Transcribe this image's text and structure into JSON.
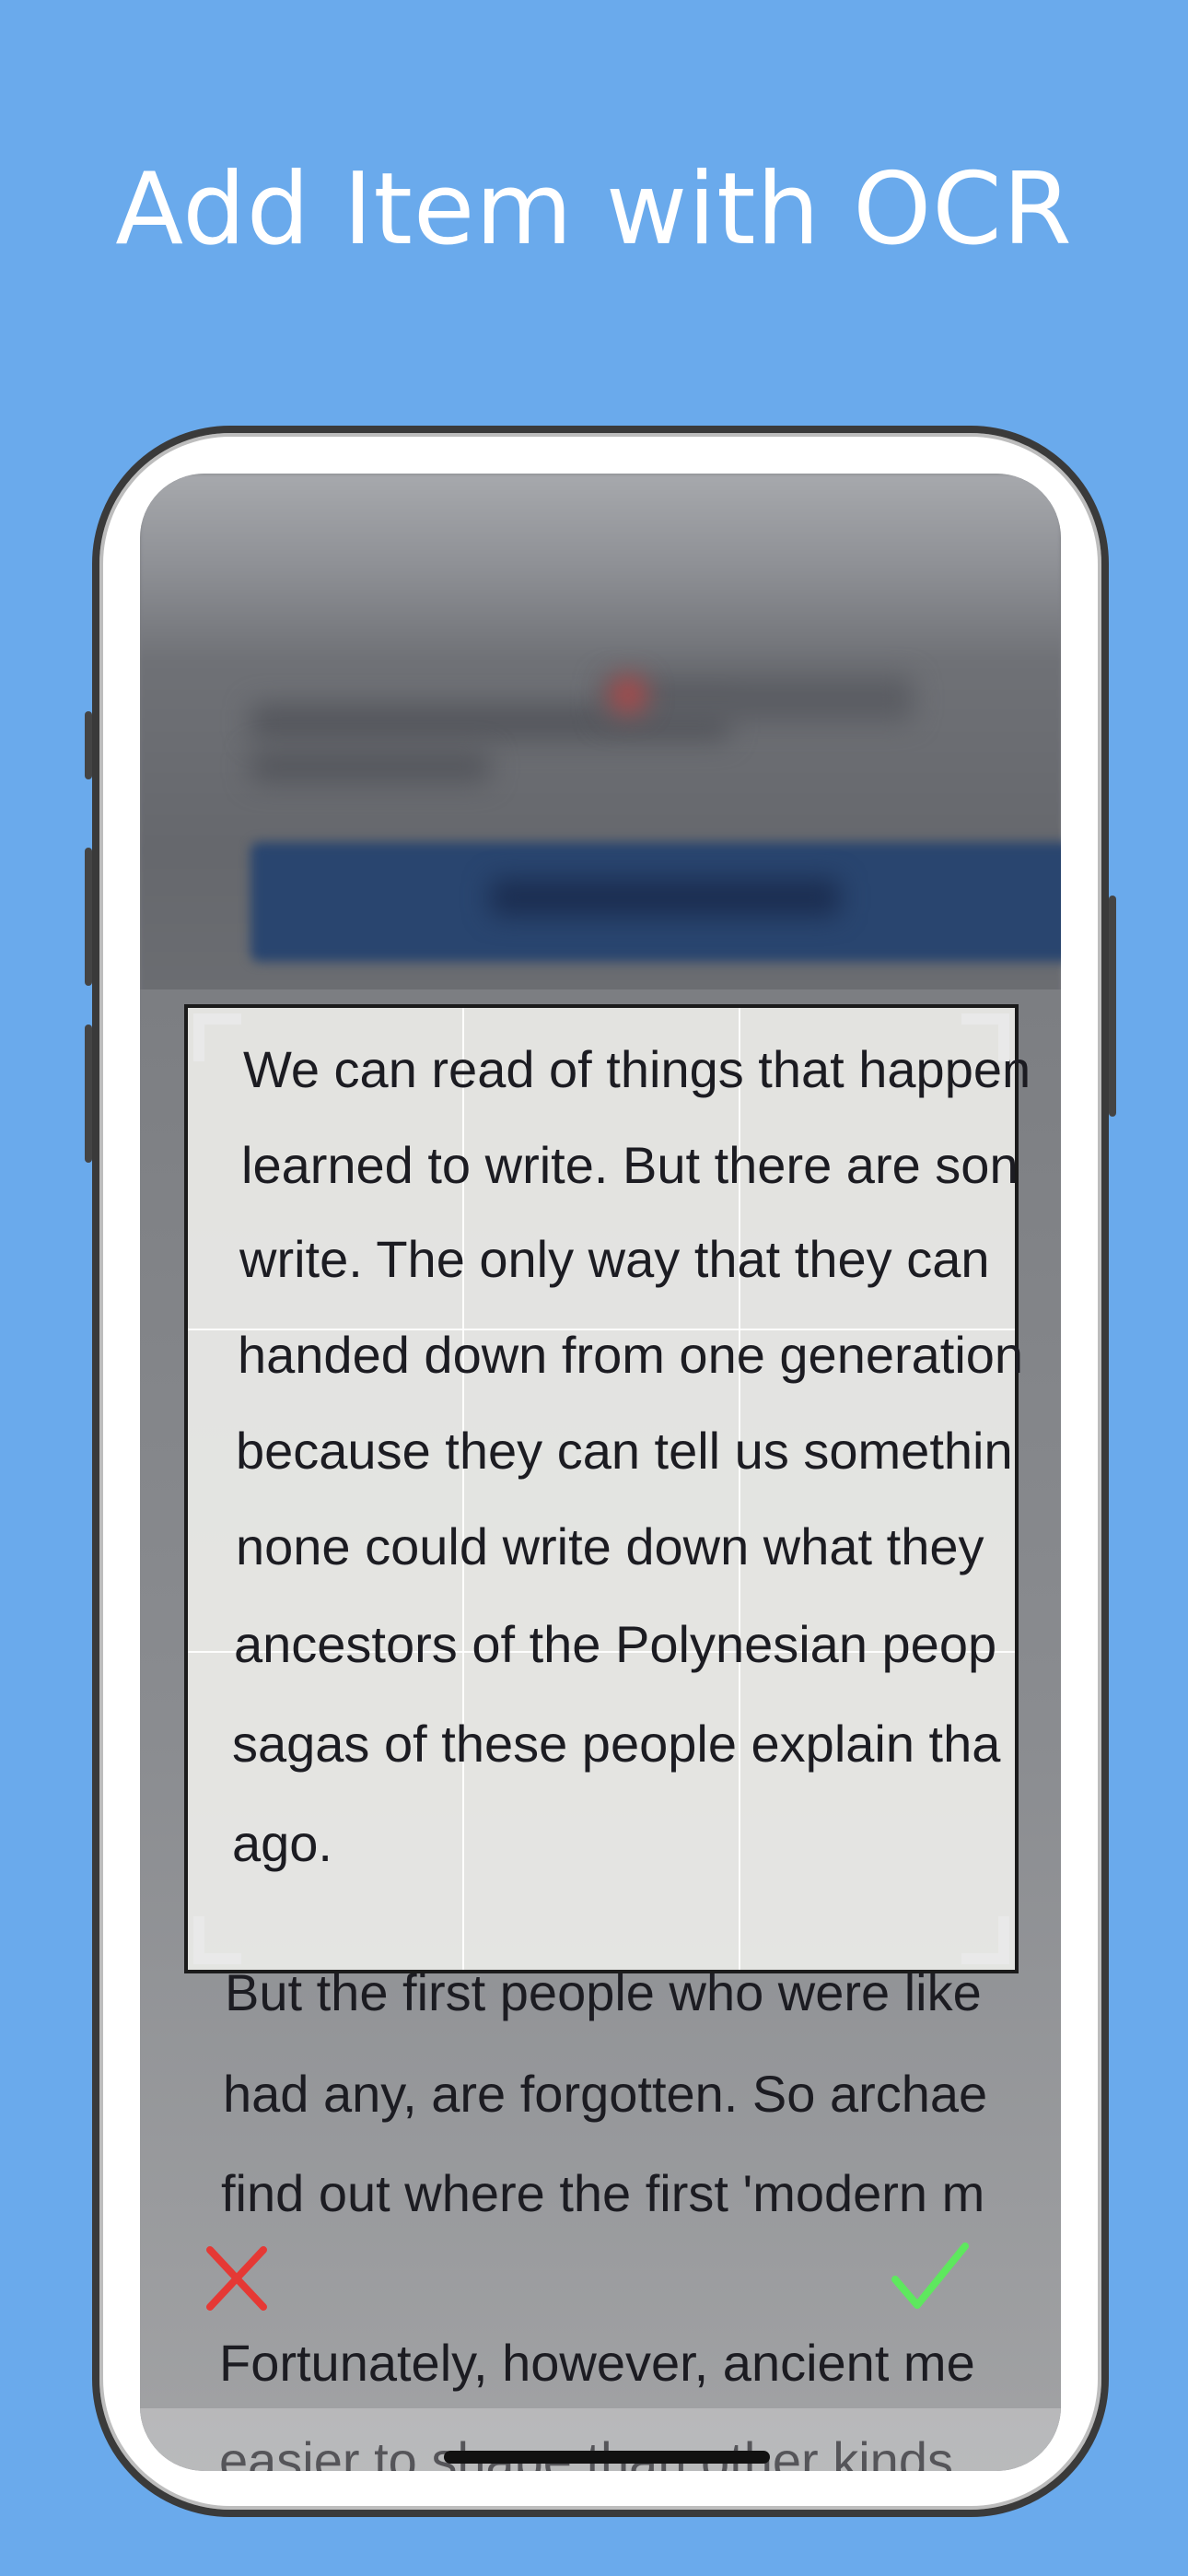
{
  "header": {
    "title": "Add Item with OCR"
  },
  "scan": {
    "selected_lines": [
      "We can read of things that happen",
      "learned to write. But there are son",
      "write. The only way that they can",
      "handed down from one generation",
      "because they can tell us somethin",
      "none could write down what they",
      "ancestors of the Polynesian peop",
      "sagas of these people explain tha",
      "ago."
    ],
    "outside_lines": [
      "But the first people who were like",
      "had any, are forgotten. So archae",
      "find out where the first 'modern m",
      "Fortunately, however, ancient me",
      "easier to shape than other kinds"
    ]
  },
  "actions": {
    "cancel": "cancel",
    "confirm": "confirm"
  },
  "colors": {
    "background": "#6aaaec",
    "cancel": "#e53935",
    "confirm": "#5ee85e"
  }
}
